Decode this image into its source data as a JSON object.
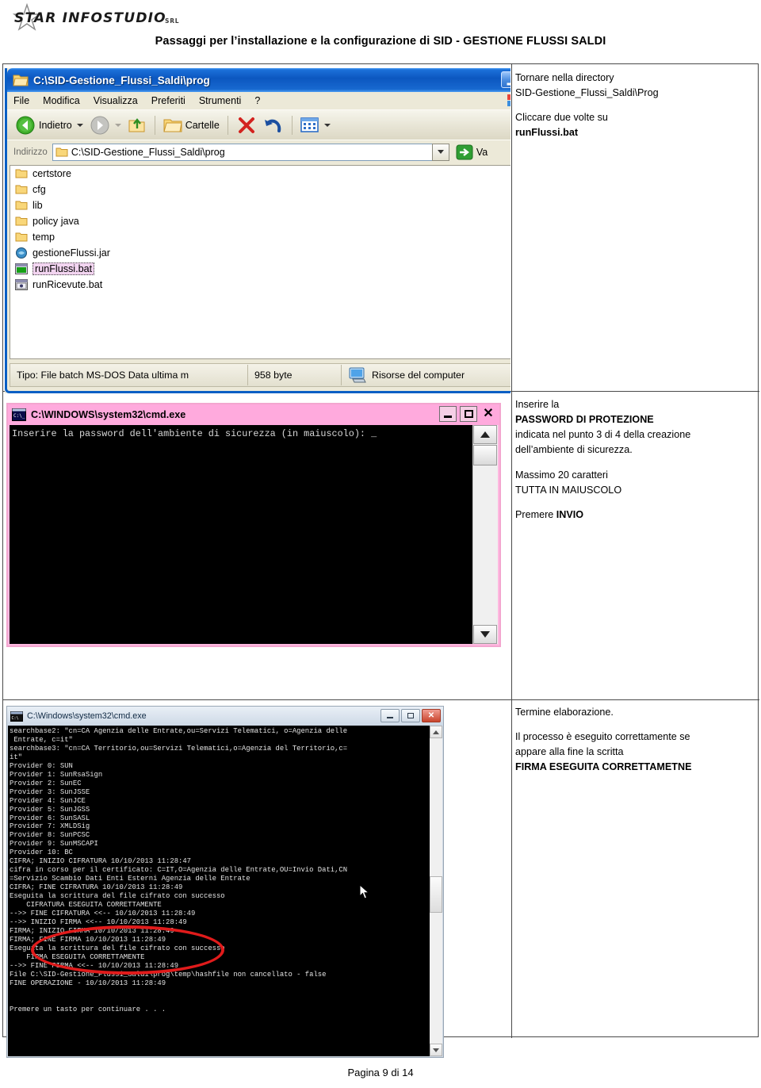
{
  "header": {
    "logo_text": "STAR INFOSTUDIO",
    "logo_suffix": "SRL",
    "title": "Passaggi per l’installazione e la configurazione di SID - GESTIONE FLUSSI SALDI"
  },
  "footer": {
    "page_label": "Pagina 9 di 14"
  },
  "colors": {
    "xp_title_blue": "#0c57c0",
    "cmd1_pink": "#ffaadd",
    "console_black": "#000000",
    "annotation_red": "#e01b1b",
    "selection_pink": "#f2d4f0"
  },
  "explorer": {
    "title": "C:\\SID-Gestione_Flussi_Saldi\\prog",
    "window_buttons": [
      "minimize",
      "maximize",
      "close"
    ],
    "menu": [
      "File",
      "Modifica",
      "Visualizza",
      "Preferiti",
      "Strumenti",
      "?"
    ],
    "toolbar": {
      "back_label": "Indietro",
      "forward_label": "",
      "up_label": "",
      "folders_label": "Cartelle",
      "delete_label": "",
      "undo_label": "",
      "views_label": ""
    },
    "address": {
      "label": "Indirizzo",
      "value": "C:\\SID-Gestione_Flussi_Saldi\\prog",
      "go_label": "Va"
    },
    "files": [
      {
        "name": "certstore",
        "type": "folder",
        "selected": false
      },
      {
        "name": "cfg",
        "type": "folder",
        "selected": false
      },
      {
        "name": "lib",
        "type": "folder",
        "selected": false
      },
      {
        "name": "policy java",
        "type": "folder",
        "selected": false
      },
      {
        "name": "temp",
        "type": "folder",
        "selected": false
      },
      {
        "name": "gestioneFlussi.jar",
        "type": "jar",
        "selected": false
      },
      {
        "name": "runFlussi.bat",
        "type": "bat",
        "selected": true
      },
      {
        "name": "runRicevute.bat",
        "type": "bat",
        "selected": false
      }
    ],
    "status": {
      "type_info": "Tipo: File batch MS-DOS Data ultima m",
      "size": "958 byte",
      "location": "Risorse del computer"
    }
  },
  "cmd_password": {
    "title": "C:\\WINDOWS\\system32\\cmd.exe",
    "output": "Inserire la password dell'ambiente di sicurezza (in maiuscolo): _"
  },
  "cmd_log": {
    "title": "C:\\Windows\\system32\\cmd.exe",
    "output": "searchbase2: \"cn=CA Agenzia delle Entrate,ou=Servizi Telematici, o=Agenzia delle\n Entrate, c=it\"\nsearchbase3: \"cn=CA Territorio,ou=Servizi Telematici,o=Agenzia del Territorio,c=\nit\"\nProvider 0: SUN\nProvider 1: SunRsaSign\nProvider 2: SunEC\nProvider 3: SunJSSE\nProvider 4: SunJCE\nProvider 5: SunJGSS\nProvider 6: SunSASL\nProvider 7: XMLDSig\nProvider 8: SunPCSC\nProvider 9: SunMSCAPI\nProvider 10: BC\nCIFRA; INIZIO CIFRATURA 10/10/2013 11:28:47\ncifra in corso per il certificato: C=IT,O=Agenzia delle Entrate,OU=Invio Dati,CN\n=Servizio Scambio Dati Enti Esterni Agenzia delle Entrate\nCIFRA; FINE CIFRATURA 10/10/2013 11:28:49\nEseguita la scrittura del file cifrato con successo\n    CIFRATURA ESEGUITA CORRETTAMENTE\n-->> FINE CIFRATURA <<-- 10/10/2013 11:28:49\n-->> INIZIO FIRMA <<-- 10/10/2013 11:28:49\nFIRMA; INIZIO FIRMA 10/10/2013 11:28:49\nFIRMA; FINE FIRMA 10/10/2013 11:28:49\nEseguita la scrittura del file cifrato con successo\n    FIRMA ESEGUITA CORRETTAMENTE\n-->> FINE FIRMA <<-- 10/10/2013 11:28:49\nFile C:\\SID-Gestione_Flussi_Saldi\\prog\\temp\\hashfile non cancellato - false\nFINE OPERAZIONE - 10/10/2013 11:28:49\n\n\nPremere un tasto per continuare . . ."
  },
  "notes": {
    "note1": {
      "line1": "Tornare nella directory",
      "line2": "SID-Gestione_Flussi_Saldi\\Prog",
      "line3": "Cliccare due volte su",
      "line4_bold": "runFlussi.bat"
    },
    "note2": {
      "line1": "Inserire la",
      "line2_bold": "PASSWORD DI PROTEZIONE",
      "line3": "indicata nel punto 3 di 4 della creazione",
      "line4": "dell’ambiente di sicurezza.",
      "line5": "Massimo 20 caratteri",
      "line6": "TUTTA IN MAIUSCOLO",
      "line7": "Premere ",
      "line7_bold": "INVIO"
    },
    "note3": {
      "line1": "Termine elaborazione.",
      "line2": "Il processo è eseguito correttamente se",
      "line3": "appare alla fine la scritta",
      "line4_bold": "FIRMA ESEGUITA CORRETTAMETNE"
    }
  }
}
